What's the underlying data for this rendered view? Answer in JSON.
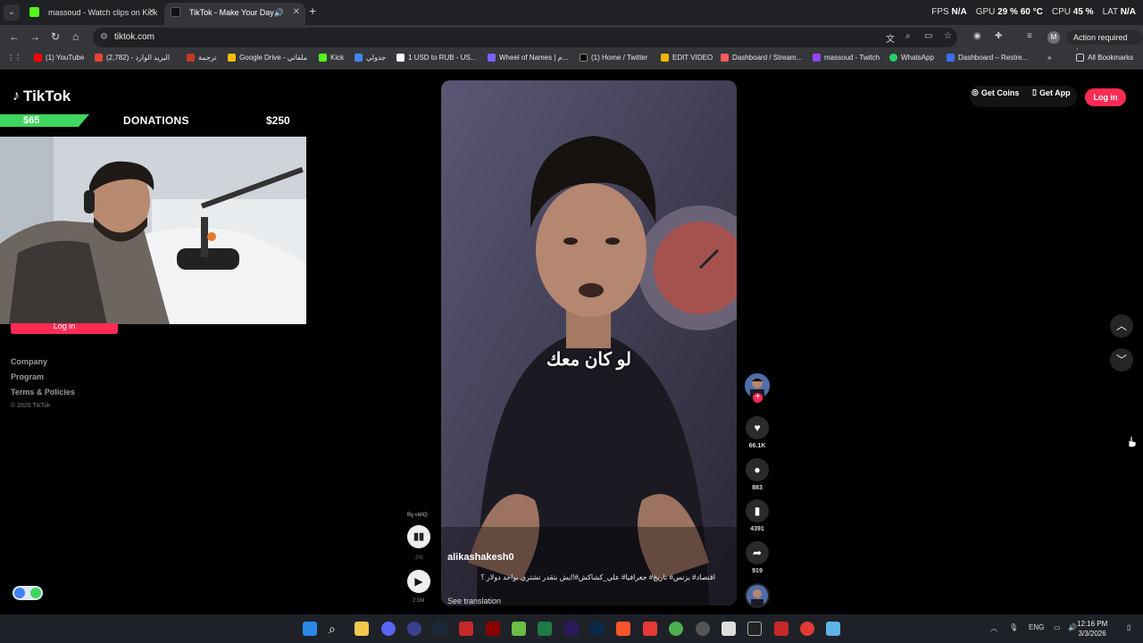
{
  "browser": {
    "tabs": [
      {
        "title": "massoud - Watch clips on Kick",
        "active": false,
        "icon_color": "#53fc18"
      },
      {
        "title": "TikTok - Make Your Day",
        "active": true,
        "icon_color": "#000000"
      }
    ],
    "stats": {
      "fps_label": "FPS",
      "fps_value": "N/A",
      "gpu_label": "GPU",
      "gpu_value": "29 % 60 °C",
      "cpu_label": "CPU",
      "cpu_value": "45 %",
      "lat_label": "LAT",
      "lat_value": "N/A"
    },
    "url": "tiktok.com",
    "action_required": "Action required",
    "profile_initial": "M",
    "bookmarks": [
      {
        "label": "(1) YouTube",
        "color": "#ff0000"
      },
      {
        "label": "البريد الوارد - (2,782)",
        "color": "#ea4335"
      },
      {
        "label": "ترجمة",
        "color": "#c53929"
      },
      {
        "label": "Google Drive - ملفاتي",
        "color": "#fbbc04"
      },
      {
        "label": "Kick",
        "color": "#53fc18"
      },
      {
        "label": "جدولي",
        "color": "#4285f4"
      },
      {
        "label": "1 USD to RUB - US...",
        "color": "#ffffff"
      },
      {
        "label": "Wheel of Names | م...",
        "color": "#7b61ff"
      },
      {
        "label": "(1) Home / Twitter",
        "color": "#000000"
      },
      {
        "label": "EDIT VIDEO",
        "color": "#f4b400"
      },
      {
        "label": "Dashboard / Stream...",
        "color": "#ff5a5f"
      },
      {
        "label": "massoud - Twitch",
        "color": "#9146ff"
      },
      {
        "label": "WhatsApp",
        "color": "#25d366"
      },
      {
        "label": "Dashboard – Restre...",
        "color": "#3d6cf4"
      }
    ],
    "all_bookmarks": "All Bookmarks"
  },
  "overlay": {
    "donation_amount": "$65",
    "donation_title": "DONATIONS",
    "donation_goal": "$250",
    "donation_progress": 0.26
  },
  "tiktok": {
    "logo": "TikTok",
    "get_coins": "Get Coins",
    "get_app": "Get App",
    "login": "Log in",
    "sidebar_login": "Log in",
    "footer": [
      "Company",
      "Program",
      "Terms & Policies"
    ],
    "copyright": "© 2026 TikTok",
    "video": {
      "subtitle": "لو كان معك",
      "username": "alikashakesh0",
      "description": "اقتصاد# بزنس# تاريخ# جغرافيا# علي_كشاكش#!ايش بتقدر تشتري بواحد دولار ؟",
      "see_translation": "See translation"
    },
    "counts": {
      "likes": "66.1K",
      "comments": "883",
      "saves": "4391",
      "shares": "919"
    },
    "vidiq": {
      "by": "By vidIQ",
      "percent": "2%",
      "views": "2.5M"
    }
  },
  "taskbar": {
    "lang": "ENG",
    "time": "12:16 PM",
    "date": "3/3/2026"
  }
}
